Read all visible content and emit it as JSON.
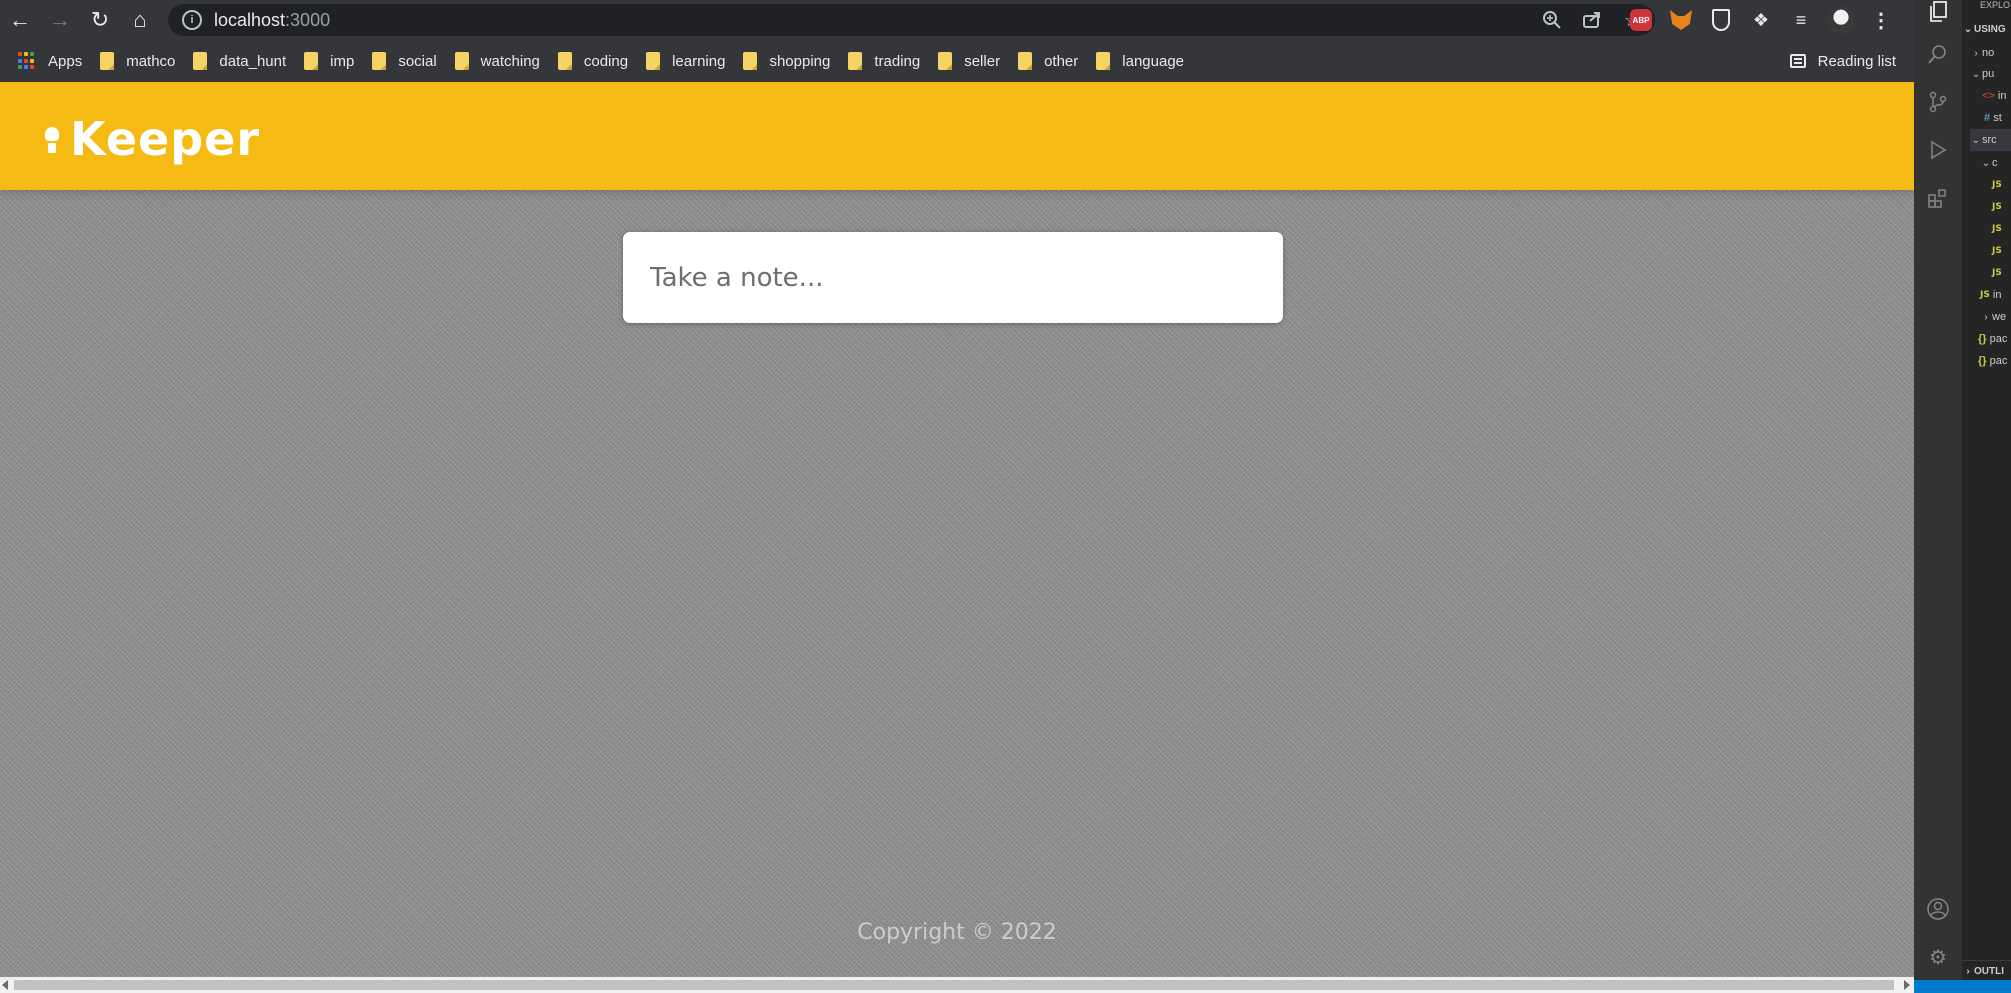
{
  "browser": {
    "url_host": "localhost",
    "url_port": ":3000",
    "bookmarks": [
      {
        "label": "Apps"
      },
      {
        "label": "mathco"
      },
      {
        "label": "data_hunt"
      },
      {
        "label": "imp"
      },
      {
        "label": "social"
      },
      {
        "label": "watching"
      },
      {
        "label": "coding"
      },
      {
        "label": "learning"
      },
      {
        "label": "shopping"
      },
      {
        "label": "trading"
      },
      {
        "label": "seller"
      },
      {
        "label": "other"
      },
      {
        "label": "language"
      }
    ],
    "reading_list": "Reading list",
    "extensions": {
      "abp": "ABP"
    }
  },
  "app": {
    "title": "Keeper",
    "note_placeholder": "Take a note...",
    "footer": "Copyright © 2022",
    "header_color": "#f5ba13"
  },
  "vscode": {
    "header_partial": "EXPLO",
    "section_partial": "USING",
    "tree": [
      "no",
      "pu",
      "in",
      "st",
      "src",
      "c",
      "",
      "",
      "",
      "",
      "",
      "in",
      "we",
      "pac",
      "pac"
    ],
    "outline_partial": "OUTLI"
  },
  "icons": {
    "back": "arrow-left-icon",
    "forward": "arrow-right-icon",
    "reload": "reload-icon",
    "home": "home-icon",
    "zoom": "zoom-icon",
    "share": "share-icon",
    "star": "star-icon"
  }
}
